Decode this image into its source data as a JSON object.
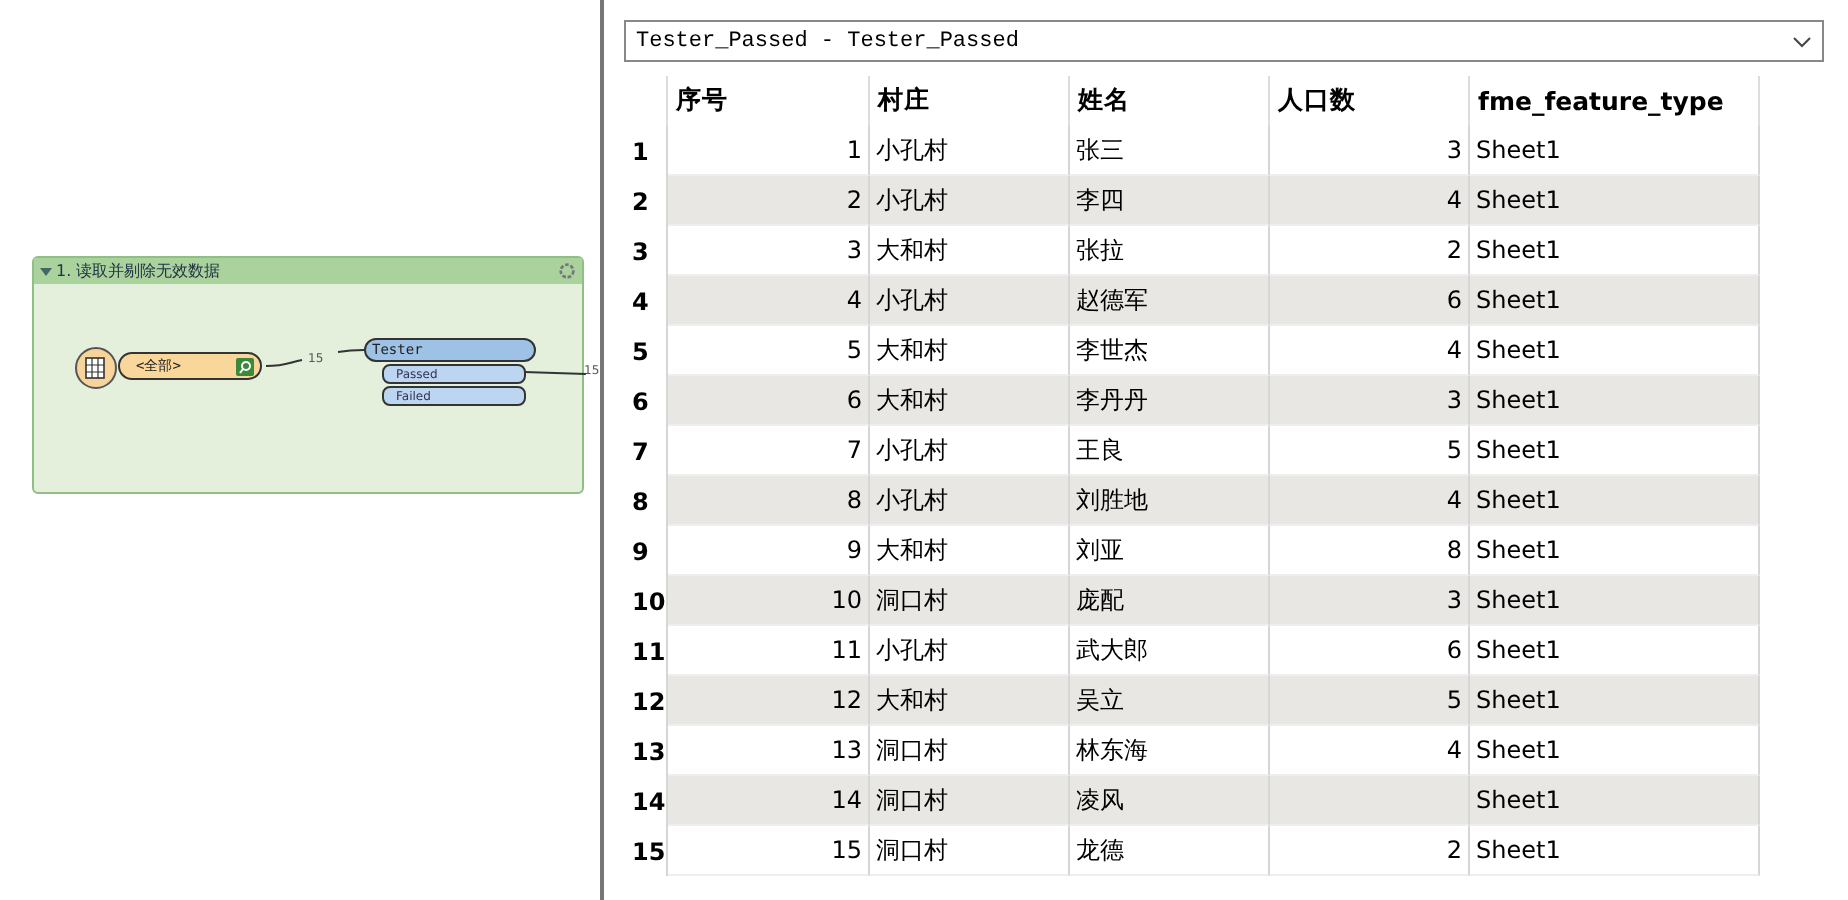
{
  "canvas": {
    "bookmark": {
      "title": "1. 读取并剔除无效数据",
      "expanded": true
    },
    "reader": {
      "label": "<全部>"
    },
    "tester": {
      "title": "Tester",
      "ports": [
        "Passed",
        "Failed"
      ]
    },
    "links": [
      {
        "count": "15"
      },
      {
        "count": "15"
      }
    ]
  },
  "viewer": {
    "dropdown": "Tester_Passed - Tester_Passed",
    "columns": [
      "序号",
      "村庄",
      "姓名",
      "人口数",
      "fme_feature_type"
    ],
    "rows": [
      {
        "index": "1",
        "cells": [
          "1",
          "小孔村",
          "张三",
          "3",
          "Sheet1"
        ]
      },
      {
        "index": "2",
        "cells": [
          "2",
          "小孔村",
          "李四",
          "4",
          "Sheet1"
        ]
      },
      {
        "index": "3",
        "cells": [
          "3",
          "大和村",
          "张拉",
          "2",
          "Sheet1"
        ]
      },
      {
        "index": "4",
        "cells": [
          "4",
          "小孔村",
          "赵德军",
          "6",
          "Sheet1"
        ]
      },
      {
        "index": "5",
        "cells": [
          "5",
          "大和村",
          "李世杰",
          "4",
          "Sheet1"
        ]
      },
      {
        "index": "6",
        "cells": [
          "6",
          "大和村",
          "李丹丹",
          "3",
          "Sheet1"
        ]
      },
      {
        "index": "7",
        "cells": [
          "7",
          "小孔村",
          "王良",
          "5",
          "Sheet1"
        ]
      },
      {
        "index": "8",
        "cells": [
          "8",
          "小孔村",
          "刘胜地",
          "4",
          "Sheet1"
        ]
      },
      {
        "index": "9",
        "cells": [
          "9",
          "大和村",
          "刘亚",
          "8",
          "Sheet1"
        ]
      },
      {
        "index": "10",
        "cells": [
          "10",
          "洞口村",
          "庞配",
          "3",
          "Sheet1"
        ]
      },
      {
        "index": "11",
        "cells": [
          "11",
          "小孔村",
          "武大郎",
          "6",
          "Sheet1"
        ]
      },
      {
        "index": "12",
        "cells": [
          "12",
          "大和村",
          "吴立",
          "5",
          "Sheet1"
        ]
      },
      {
        "index": "13",
        "cells": [
          "13",
          "洞口村",
          "林东海",
          "4",
          "Sheet1"
        ]
      },
      {
        "index": "14",
        "cells": [
          "14",
          "洞口村",
          "凌风",
          null,
          "Sheet1"
        ]
      },
      {
        "index": "15",
        "cells": [
          "15",
          "洞口村",
          "龙德",
          "2",
          "Sheet1"
        ]
      }
    ]
  }
}
